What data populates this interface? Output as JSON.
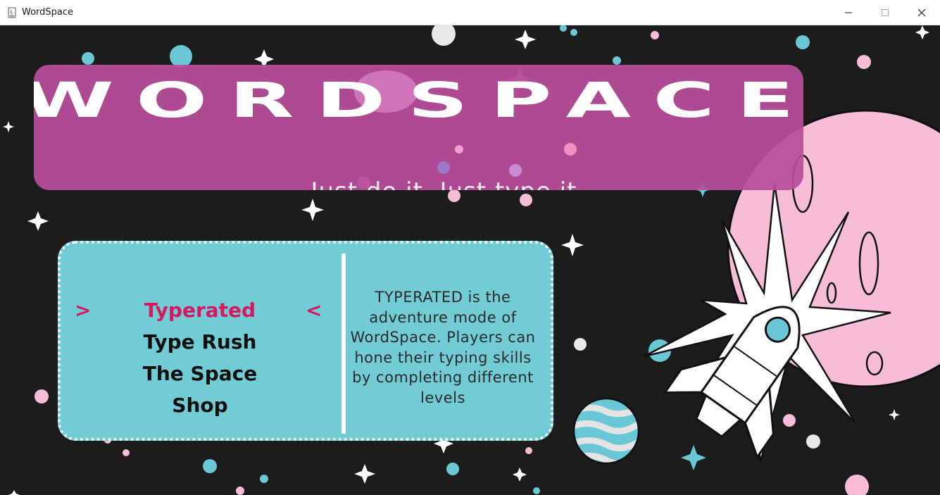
{
  "window": {
    "title": "WordSpace",
    "app_icon": "java-app-icon",
    "controls": [
      "minimize-icon",
      "maximize-icon",
      "close-icon"
    ]
  },
  "header": {
    "logo": "WORDSPACE",
    "tagline": "Just do it, Just type it"
  },
  "menu": {
    "items": [
      {
        "label": "Typerated",
        "selected": true
      },
      {
        "label": "Type Rush",
        "selected": false
      },
      {
        "label": "The Space",
        "selected": false
      },
      {
        "label": "Shop",
        "selected": false
      }
    ],
    "left_arrow": ">",
    "right_arrow": "<",
    "description": "TYPERATED is the adventure mode of WordSpace. Players can hone their typing skills by completing different levels"
  },
  "colors": {
    "background": "#1c1c1c",
    "banner": "#b94e9b",
    "card": "#72ccd6",
    "selected": "#d6185f",
    "planet_pink": "#f7bdd6",
    "star": "#ffffff"
  }
}
